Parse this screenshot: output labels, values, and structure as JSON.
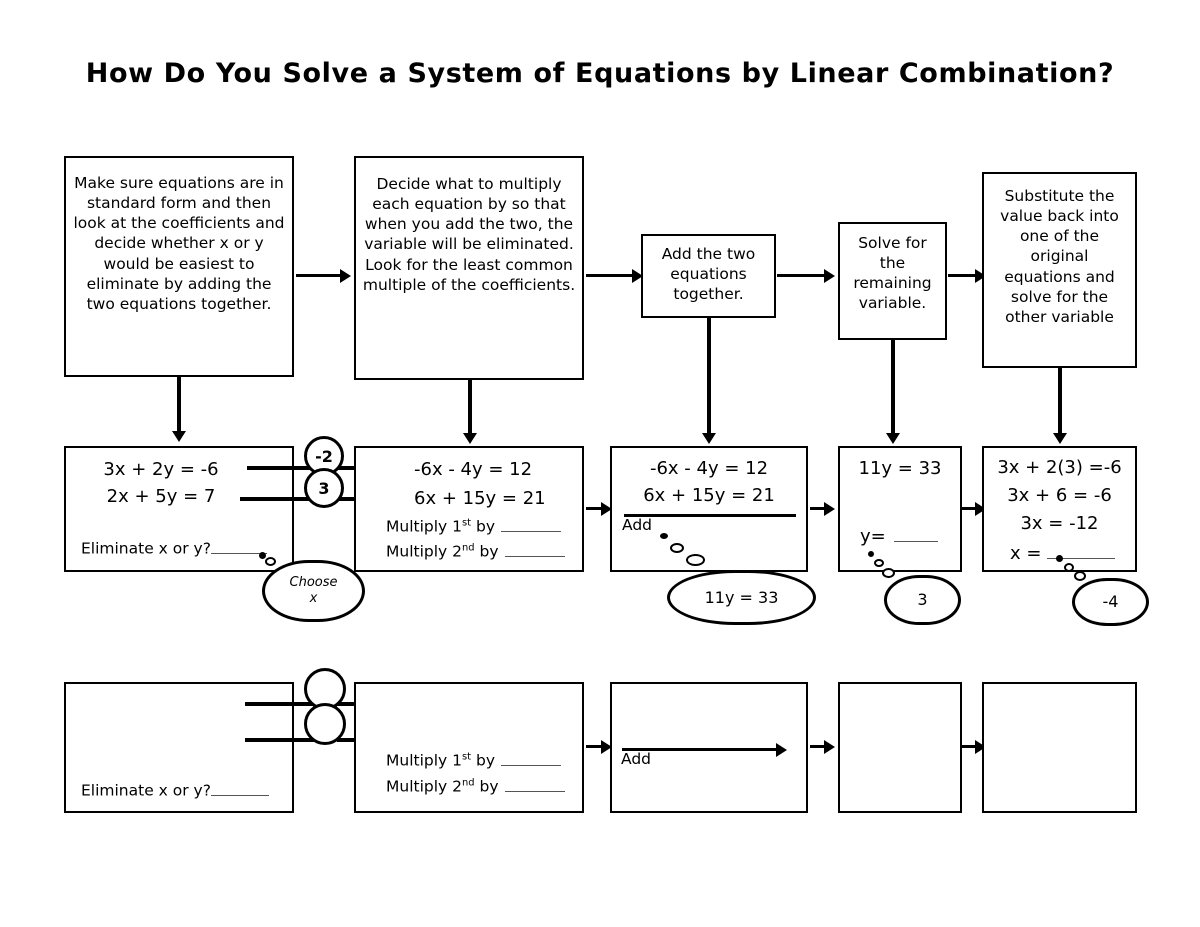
{
  "page": {
    "title": "How Do You Solve a System of Equations by Linear Combination?"
  },
  "colors": {
    "ink": "#000000",
    "paper": "#ffffff",
    "blank_rule": "#555555"
  },
  "steps_row": {
    "label": "Step description boxes",
    "boxes": [
      {
        "id": "step-1",
        "text": "Make sure equations are in standard form and then look at the coefficients and decide whether x or y would be easiest to eliminate by adding the two equations together."
      },
      {
        "id": "step-2",
        "text": "Decide what to multiply each equation by so that when you add the two, the variable will be eliminated.  Look for the least common multiple of the coefficients."
      },
      {
        "id": "step-3",
        "text": "Add the two equations together."
      },
      {
        "id": "step-4",
        "text": "Solve for the remaining variable."
      },
      {
        "id": "step-5",
        "text": "Substitute the value back into one of the original equations and solve for the other variable"
      }
    ]
  },
  "example_row": {
    "label": "Worked example row",
    "box1": {
      "equation_1": "3x + 2y = -6",
      "equation_2": "2x + 5y = 7",
      "prompt": "Eliminate x or y?",
      "prompt_answer_blank": "",
      "multiplier_top": "-2",
      "multiplier_bottom": "3",
      "bubble_line_1": "Choose",
      "bubble_line_2": "x"
    },
    "box2": {
      "equation_1": "-6x - 4y = 12",
      "equation_2": "6x + 15y = 21",
      "multiply_first_label": "Multiply 1",
      "multiply_first_ordinal": "st",
      "multiply_first_suffix": " by",
      "multiply_second_label": "Multiply 2",
      "multiply_second_ordinal": "nd",
      "multiply_second_suffix": " by"
    },
    "box3": {
      "equation_1": "-6x - 4y = 12",
      "equation_2": "6x + 15y = 21",
      "operation": "Add",
      "bubble": "11y = 33"
    },
    "box4": {
      "equation_1": "11y = 33",
      "solve_label": "y=",
      "bubble": "3"
    },
    "box5": {
      "equation_1": "3x + 2(3) =-6",
      "equation_2": "3x + 6 = -6",
      "equation_3": "3x = -12",
      "solve_label": "x =",
      "bubble": "-4"
    }
  },
  "practice_row": {
    "label": "Blank practice row",
    "box1": {
      "prompt": "Eliminate x or y?",
      "multiplier_top": "",
      "multiplier_bottom": ""
    },
    "box2": {
      "multiply_first_label": "Multiply 1",
      "multiply_first_ordinal": "st",
      "multiply_first_suffix": " by",
      "multiply_second_label": "Multiply 2",
      "multiply_second_ordinal": "nd",
      "multiply_second_suffix": " by"
    },
    "box3": {
      "operation": "Add"
    },
    "box4": {
      "text": ""
    },
    "box5": {
      "text": ""
    }
  }
}
